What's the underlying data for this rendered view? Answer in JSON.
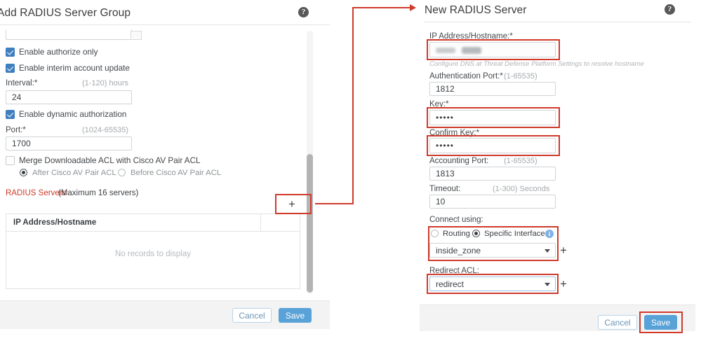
{
  "left_dialog": {
    "title": "Add RADIUS Server Group",
    "help_icon": "help-icon",
    "top_field": {
      "value": "",
      "has_dropdown_stub": true
    },
    "checkboxes": [
      {
        "label": "Enable authorize only",
        "checked": true
      },
      {
        "label": "Enable interim account update",
        "checked": true
      },
      {
        "label": "Enable dynamic authorization",
        "checked": true
      },
      {
        "label": "Merge Downloadable ACL with Cisco AV Pair ACL",
        "checked": false
      }
    ],
    "fields": [
      {
        "label": "Interval:*",
        "hint": "(1-120) hours",
        "value": "24"
      },
      {
        "label": "Port:*",
        "hint": "(1024-65535)",
        "value": "1700"
      }
    ],
    "radios": [
      {
        "label": "After Cisco AV Pair ACL",
        "selected": true
      },
      {
        "label": "Before Cisco AV Pair ACL",
        "selected": false
      }
    ],
    "servers_section": {
      "title_red": "RADIUS Servers",
      "title_rest": " (Maximum 16 servers)",
      "add_button": "+"
    },
    "table": {
      "column_header": "IP Address/Hostname",
      "empty_message": "No records to display"
    },
    "footer": {
      "cancel_label": "Cancel",
      "save_label": "Save"
    }
  },
  "right_dialog": {
    "title": "New RADIUS Server",
    "help_icon": "help-icon",
    "ip_field": {
      "label": "IP Address/Hostname:*",
      "value": "",
      "redacted": true,
      "note": "Configure DNS at Threat Defense Platform Settings to resolve hostname"
    },
    "fields": [
      {
        "label": "Authentication Port:*",
        "hint": "(1-65535)",
        "value": "1812"
      },
      {
        "label": "Key:*",
        "hint": "",
        "value": "•••••"
      },
      {
        "label": "Confirm Key:*",
        "hint": "",
        "value": "•••••"
      },
      {
        "label": "Accounting Port:",
        "hint": "(1-65535)",
        "value": "1813"
      },
      {
        "label": "Timeout:",
        "hint": "(1-300) Seconds",
        "value": "10"
      }
    ],
    "connect_using": {
      "label": "Connect using:",
      "radios": [
        {
          "label": "Routing",
          "selected": false
        },
        {
          "label": "Specific Interface",
          "selected": true
        }
      ],
      "info_icon": "info-icon",
      "select_value": "inside_zone",
      "add_button": "+"
    },
    "redirect_acl": {
      "label": "Redirect ACL:",
      "select_value": "redirect",
      "add_button": "+"
    },
    "footer": {
      "cancel_label": "Cancel",
      "save_label": "Save"
    }
  },
  "annotations": {
    "accent_color": "#cf3a2b",
    "highlight_targets": [
      "add-server-plus-button",
      "ip-address-field",
      "key-field",
      "confirm-key-field",
      "connect-using-group",
      "redirect-acl-select",
      "right-save-button"
    ],
    "connector": "plus-button-to-new-radius-server-title"
  },
  "colors": {
    "primary_button": "#59a2d8",
    "checkbox_on": "#3f7fbf",
    "red_text": "#cf3a2b",
    "footer_bg": "#f3f3f3"
  }
}
